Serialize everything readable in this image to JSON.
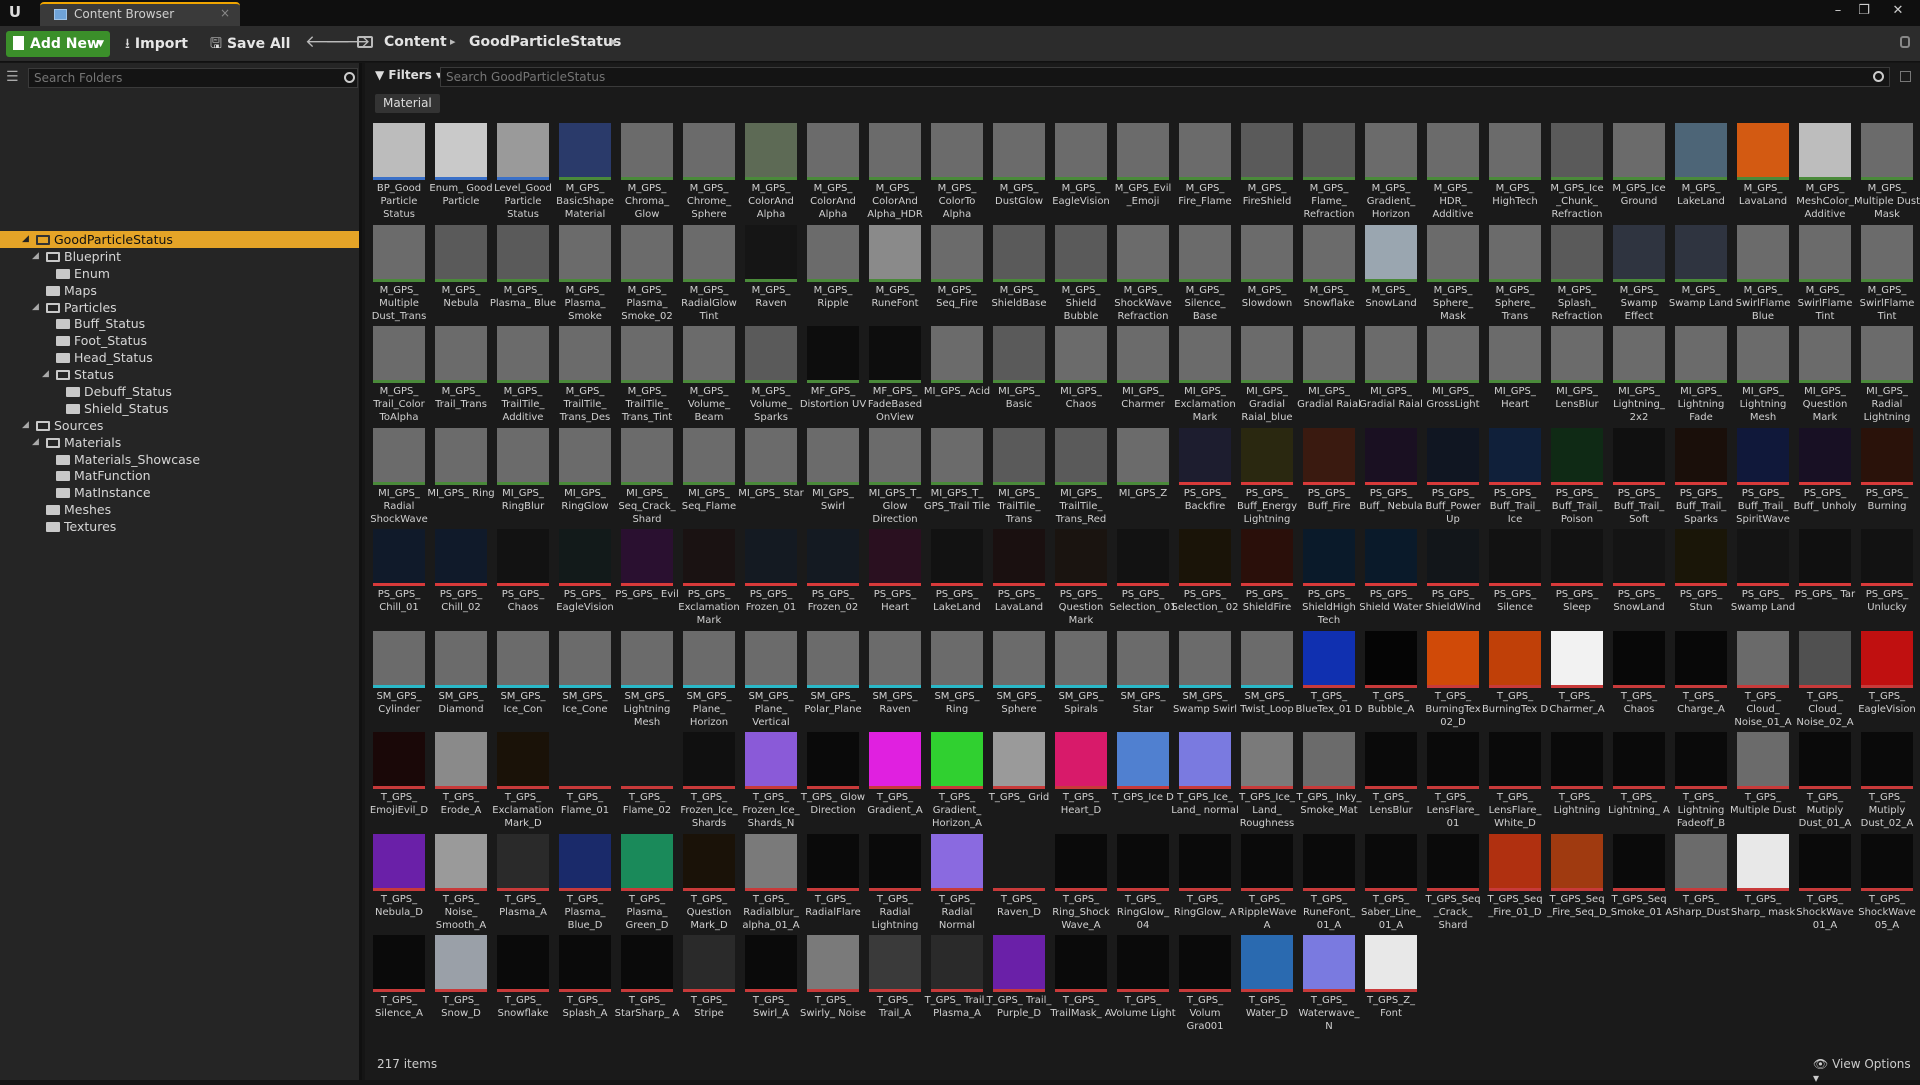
{
  "window": {
    "tab_title": "Content Browser",
    "logo": "U",
    "close": "×",
    "win_min": "–",
    "win_max": "❐",
    "win_close": "✕"
  },
  "toolbar": {
    "add_new": "Add New",
    "import": "Import",
    "save_all": "Save All",
    "back": "🡐",
    "forward": "🡒",
    "crumbs": [
      "Content",
      "GoodParticleStatus"
    ],
    "sep": "▸"
  },
  "sidebar": {
    "search_placeholder": "Search Folders",
    "tree": [
      {
        "label": "GoodParticleStatus",
        "depth": 0,
        "open": true,
        "selected": true
      },
      {
        "label": "Blueprint",
        "depth": 1,
        "open": true
      },
      {
        "label": "Enum",
        "depth": 2
      },
      {
        "label": "Maps",
        "depth": 1
      },
      {
        "label": "Particles",
        "depth": 1,
        "open": true
      },
      {
        "label": "Buff_Status",
        "depth": 2
      },
      {
        "label": "Foot_Status",
        "depth": 2
      },
      {
        "label": "Head_Status",
        "depth": 2
      },
      {
        "label": "Status",
        "depth": 2,
        "open": true
      },
      {
        "label": "Debuff_Status",
        "depth": 3
      },
      {
        "label": "Shield_Status",
        "depth": 3
      },
      {
        "label": "Sources",
        "depth": 0,
        "open": true
      },
      {
        "label": "Materials",
        "depth": 1,
        "open": true
      },
      {
        "label": "Materials_Showcase",
        "depth": 2
      },
      {
        "label": "MatFunction",
        "depth": 2
      },
      {
        "label": "MatInstance",
        "depth": 2
      },
      {
        "label": "Meshes",
        "depth": 1
      },
      {
        "label": "Textures",
        "depth": 1
      }
    ]
  },
  "main": {
    "filters_label": "Filters",
    "search_placeholder": "Search GoodParticleStatus",
    "filter_chip": "Material",
    "item_count": "217 items",
    "view_options": "View Options"
  },
  "assets": [
    [
      "BP_Good Particle Status",
      "#bcbcbc"
    ],
    [
      "Enum_ Good Particle",
      "#c9c9c9"
    ],
    [
      "Level_Good Particle Status",
      "#9a9a9a"
    ],
    [
      "M_GPS_ BasicShape Material",
      "#2a3a6a"
    ],
    [
      "M_GPS_ Chroma_ Glow",
      "#6b6b6b"
    ],
    [
      "M_GPS_ Chrome_ Sphere",
      "#6b6b6b"
    ],
    [
      "M_GPS_ ColorAnd Alpha",
      "#5d6a55"
    ],
    [
      "M_GPS_ ColorAnd Alpha",
      "#6b6b6b"
    ],
    [
      "M_GPS_ ColorAnd Alpha_HDR",
      "#6b6b6b"
    ],
    [
      "M_GPS_ ColorTo Alpha",
      "#6b6b6b"
    ],
    [
      "M_GPS_ DustGlow",
      "#6b6b6b"
    ],
    [
      "M_GPS_ EagleVision",
      "#6b6b6b"
    ],
    [
      "M_GPS_Evil _Emoji",
      "#6b6b6b"
    ],
    [
      "M_GPS_ Fire_Flame",
      "#6b6b6b"
    ],
    [
      "M_GPS_ FireShield",
      "#5a5a5a"
    ],
    [
      "M_GPS_ Flame_ Refraction",
      "#5a5a5a"
    ],
    [
      "M_GPS_ Gradient_ Horizon",
      "#6b6b6b"
    ],
    [
      "M_GPS_ HDR_ Additive",
      "#6b6b6b"
    ],
    [
      "M_GPS_ HighTech",
      "#6b6b6b"
    ],
    [
      "M_GPS_Ice _Chunk_ Refraction",
      "#5a5a5a"
    ],
    [
      "M_GPS_Ice Ground",
      "#6b6b6b"
    ],
    [
      "M_GPS_ LakeLand",
      "#4d6577"
    ],
    [
      "M_GPS_ LavaLand",
      "#d35a12"
    ],
    [
      "M_GPS_ MeshColor_ Additive",
      "#bdbdbd"
    ],
    [
      "M_GPS_ Multiple Dust Mask",
      "#6b6b6b"
    ],
    [
      "M_GPS_ Multiple Dust_Trans",
      "#6b6b6b"
    ],
    [
      "M_GPS_ Nebula",
      "#5a5a5a"
    ],
    [
      "M_GPS_ Plasma_ Blue",
      "#5a5a5a"
    ],
    [
      "M_GPS_ Plasma_ Smoke",
      "#6b6b6b"
    ],
    [
      "M_GPS_ Plasma_ Smoke_02",
      "#6b6b6b"
    ],
    [
      "M_GPS_ RadialGlow Tint",
      "#6b6b6b"
    ],
    [
      "M_GPS_ Raven",
      "#151515"
    ],
    [
      "M_GPS_ Ripple",
      "#6b6b6b"
    ],
    [
      "M_GPS_ RuneFont",
      "#8a8a8a"
    ],
    [
      "M_GPS_ Seq_Fire",
      "#6b6b6b"
    ],
    [
      "M_GPS_ ShieldBase",
      "#5a5a5a"
    ],
    [
      "M_GPS_ Shield Bubble",
      "#5a5a5a"
    ],
    [
      "M_GPS_ ShockWave Refraction",
      "#6b6b6b"
    ],
    [
      "M_GPS_ Silence_ Base",
      "#6b6b6b"
    ],
    [
      "M_GPS_ Slowdown",
      "#6b6b6b"
    ],
    [
      "M_GPS_ Snowflake",
      "#6b6b6b"
    ],
    [
      "M_GPS_ SnowLand",
      "#9aa6b0"
    ],
    [
      "M_GPS_ Sphere_ Mask",
      "#6b6b6b"
    ],
    [
      "M_GPS_ Sphere_ Trans",
      "#6b6b6b"
    ],
    [
      "M_GPS_ Splash_ Refraction",
      "#5a5a5a"
    ],
    [
      "M_GPS_ Swamp Effect",
      "#2f3440"
    ],
    [
      "M_GPS_ Swamp Land",
      "#2f3440"
    ],
    [
      "M_GPS_ SwirlFlame Blue",
      "#6b6b6b"
    ],
    [
      "M_GPS_ SwirlFlame Tint",
      "#6b6b6b"
    ],
    [
      "M_GPS_ SwirlFlame Tint",
      "#6b6b6b"
    ],
    [
      "M_GPS_ Trail_Color ToAlpha",
      "#6b6b6b"
    ],
    [
      "M_GPS_ Trail_Trans",
      "#6b6b6b"
    ],
    [
      "M_GPS_ TrailTile_ Additive",
      "#6b6b6b"
    ],
    [
      "M_GPS_ TrailTile_ Trans_Des",
      "#6b6b6b"
    ],
    [
      "M_GPS_ TrailTile_ Trans_Tint",
      "#6b6b6b"
    ],
    [
      "M_GPS_ Volume_ Beam",
      "#6b6b6b"
    ],
    [
      "M_GPS_ Volume_ Sparks",
      "#5a5a5a"
    ],
    [
      "MF_GPS_ Distortion UV",
      "#0d0d0d"
    ],
    [
      "MF_GPS_ FadeBased OnView",
      "#0d0d0d"
    ],
    [
      "MI_GPS_ Acid",
      "#6b6b6b"
    ],
    [
      "MI_GPS_ Basic",
      "#5a5a5a"
    ],
    [
      "MI_GPS_ Chaos",
      "#6b6b6b"
    ],
    [
      "MI_GPS_ Charmer",
      "#6b6b6b"
    ],
    [
      "MI_GPS_ Exclamation Mark",
      "#6b6b6b"
    ],
    [
      "MI_GPS_ Gradial Raial_blue",
      "#6b6b6b"
    ],
    [
      "MI_GPS_ Gradial Raial",
      "#6b6b6b"
    ],
    [
      "MI_GPS_ Gradial Raial",
      "#6b6b6b"
    ],
    [
      "MI_GPS_ GrossLight",
      "#6b6b6b"
    ],
    [
      "MI_GPS_ Heart",
      "#6b6b6b"
    ],
    [
      "MI_GPS_ LensBlur",
      "#6b6b6b"
    ],
    [
      "MI_GPS_ Lightning_ 2x2",
      "#6b6b6b"
    ],
    [
      "MI_GPS_ Lightning Fade",
      "#6b6b6b"
    ],
    [
      "MI_GPS_ Lightning Mesh",
      "#6b6b6b"
    ],
    [
      "MI_GPS_ Question Mark",
      "#6b6b6b"
    ],
    [
      "MI_GPS_ Radial Lightning",
      "#6b6b6b"
    ],
    [
      "MI_GPS_ Radial ShockWave",
      "#6b6b6b"
    ],
    [
      "MI_GPS_ Ring",
      "#6b6b6b"
    ],
    [
      "MI_GPS_ RingBlur",
      "#6b6b6b"
    ],
    [
      "MI_GPS_ RingGlow",
      "#6b6b6b"
    ],
    [
      "MI_GPS_ Seq_Crack_ Shard",
      "#6b6b6b"
    ],
    [
      "MI_GPS_ Seq_Flame",
      "#6b6b6b"
    ],
    [
      "MI_GPS_ Star",
      "#6b6b6b"
    ],
    [
      "MI_GPS_ Swirl",
      "#6b6b6b"
    ],
    [
      "MI_GPS_T_ Glow Direction",
      "#6b6b6b"
    ],
    [
      "MI_GPS_T_ GPS_Trail Tile",
      "#6b6b6b"
    ],
    [
      "MI_GPS_ TrailTile_ Trans",
      "#5a5a5a"
    ],
    [
      "MI_GPS_ TrailTile_ Trans_Red",
      "#5a5a5a"
    ],
    [
      "MI_GPS_Z",
      "#6b6b6b"
    ],
    [
      "PS_GPS_ Backfire",
      "#1d1d2f"
    ],
    [
      "PS_GPS_ Buff_Energy Lightning",
      "#2a2810"
    ],
    [
      "PS_GPS_ Buff_Fire",
      "#3a1a10"
    ],
    [
      "PS_GPS_ Buff_ Nebula",
      "#1a1022"
    ],
    [
      "PS_GPS_ Buff_Power Up",
      "#101622"
    ],
    [
      "PS_GPS_ Buff_Trail_ Ice",
      "#10203a"
    ],
    [
      "PS_GPS_ Buff_Trail_ Poison",
      "#0f2a15"
    ],
    [
      "PS_GPS_ Buff_Trail_ Soft",
      "#101010"
    ],
    [
      "PS_GPS_ Buff_Trail_ Sparks",
      "#1a0f0a"
    ],
    [
      "PS_GPS_ Buff_Trail_ SpiritWave",
      "#10183a"
    ],
    [
      "PS_GPS_ Buff_ Unholy",
      "#181024"
    ],
    [
      "PS_GPS_ Burning",
      "#2a120a"
    ],
    [
      "PS_GPS_ Chill_01",
      "#101a2a"
    ],
    [
      "PS_GPS_ Chill_02",
      "#101a2a"
    ],
    [
      "PS_GPS_ Chaos",
      "#121212"
    ],
    [
      "PS_GPS_ EagleVision",
      "#121a1a"
    ],
    [
      "PS_GPS_ Evil",
      "#2a1030"
    ],
    [
      "PS_GPS_ Exclamation Mark",
      "#1a1212"
    ],
    [
      "PS_GPS_ Frozen_01",
      "#141a22"
    ],
    [
      "PS_GPS_ Frozen_02",
      "#141a22"
    ],
    [
      "PS_GPS_ Heart",
      "#2a1020"
    ],
    [
      "PS_GPS_ LakeLand",
      "#121212"
    ],
    [
      "PS_GPS_ LavaLand",
      "#1a1010"
    ],
    [
      "PS_GPS_ Question Mark",
      "#1a1410"
    ],
    [
      "PS_GPS_ Selection_ 01",
      "#121212"
    ],
    [
      "PS_GPS_ Selection_ 02",
      "#1a1408"
    ],
    [
      "PS_GPS_ ShieldFire",
      "#2a0f0a"
    ],
    [
      "PS_GPS_ ShieldHigh Tech",
      "#0a1a2a"
    ],
    [
      "PS_GPS_ Shield Water",
      "#0a1a2a"
    ],
    [
      "PS_GPS_ ShieldWind",
      "#12161a"
    ],
    [
      "PS_GPS_ Silence",
      "#121212"
    ],
    [
      "PS_GPS_ Sleep",
      "#121212"
    ],
    [
      "PS_GPS_ SnowLand",
      "#141414"
    ],
    [
      "PS_GPS_ Stun",
      "#1a1608"
    ],
    [
      "PS_GPS_ Swamp Land",
      "#141414"
    ],
    [
      "PS_GPS_ Tar",
      "#101010"
    ],
    [
      "PS_GPS_ Unlucky",
      "#121212"
    ],
    [
      "SM_GPS_ Cylinder",
      "#6b6b6b"
    ],
    [
      "SM_GPS_ Diamond",
      "#6b6b6b"
    ],
    [
      "SM_GPS_ Ice_Con",
      "#6b6b6b"
    ],
    [
      "SM_GPS_ Ice_Cone",
      "#6b6b6b"
    ],
    [
      "SM_GPS_ Lightning Mesh",
      "#6b6b6b"
    ],
    [
      "SM_GPS_ Plane_ Horizon",
      "#6b6b6b"
    ],
    [
      "SM_GPS_ Plane_ Vertical",
      "#6b6b6b"
    ],
    [
      "SM_GPS_ Polar_Plane",
      "#6b6b6b"
    ],
    [
      "SM_GPS_ Raven",
      "#6b6b6b"
    ],
    [
      "SM_GPS_ Ring",
      "#6b6b6b"
    ],
    [
      "SM_GPS_ Sphere",
      "#6b6b6b"
    ],
    [
      "SM_GPS_ Spirals",
      "#6b6b6b"
    ],
    [
      "SM_GPS_ Star",
      "#6b6b6b"
    ],
    [
      "SM_GPS_ Swamp Swirl",
      "#6b6b6b"
    ],
    [
      "SM_GPS_ Twist_Loop",
      "#6b6b6b"
    ],
    [
      "T_GPS_ BlueTex_01 D",
      "#1030b0"
    ],
    [
      "T_GPS_ Bubble_A",
      "#050505"
    ],
    [
      "T_GPS_ BurningTex 02_D",
      "#d04a08"
    ],
    [
      "T_GPS_ BurningTex D",
      "#c04008"
    ],
    [
      "T_GPS_ Charmer_A",
      "#f2f2f2"
    ],
    [
      "T_GPS_ Chaos",
      "#080808"
    ],
    [
      "T_GPS_ Charge_A",
      "#080808"
    ],
    [
      "T_GPS_ Cloud_ Noise_01_A",
      "#6a6a6a"
    ],
    [
      "T_GPS_ Cloud_ Noise_02_A",
      "#505050"
    ],
    [
      "T_GPS_ EagleVision",
      "#c01010"
    ],
    [
      "T_GPS_ EmojiEvil_D",
      "#1a0808"
    ],
    [
      "T_GPS_ Erode_A",
      "#8a8a8a"
    ],
    [
      "T_GPS_ Exclamation Mark_D",
      "#1a1208"
    ],
    [
      "T_GPS_ Flame_01",
      "#1a1a1a"
    ],
    [
      "T_GPS_ Flame_02",
      "#1a1a1a"
    ],
    [
      "T_GPS_ Frozen_Ice_ Shards",
      "#101010"
    ],
    [
      "T_GPS_ Frozen_Ice_ Shards_N",
      "#8a5ad8"
    ],
    [
      "T_GPS_ Glow Direction",
      "#0a0a0a"
    ],
    [
      "T_GPS_ Gradient_A",
      "#e020e0"
    ],
    [
      "T_GPS_ Gradient_ Horizon_A",
      "#30d030"
    ],
    [
      "T_GPS_ Grid",
      "#9a9a9a"
    ],
    [
      "T_GPS_ Heart_D",
      "#d81a6a"
    ],
    [
      "T_GPS_Ice D",
      "#5080d0"
    ],
    [
      "T_GPS_Ice_ Land_ normal",
      "#7a7ae0"
    ],
    [
      "T_GPS_Ice_ Land_ Roughness",
      "#7a7a7a"
    ],
    [
      "T_GPS_ Inky_ Smoke_Mat",
      "#6b6b6b"
    ],
    [
      "T_GPS_ LensBlur",
      "#0a0a0a"
    ],
    [
      "T_GPS_ LensFlare_ 01",
      "#0a0a0a"
    ],
    [
      "T_GPS_ LensFlare_ White_D",
      "#0a0a0a"
    ],
    [
      "T_GPS_ Lightning",
      "#0a0a0a"
    ],
    [
      "T_GPS_ Lightning_ A",
      "#0a0a0a"
    ],
    [
      "T_GPS_ Lightning Fadeoff_B",
      "#0a0a0a"
    ],
    [
      "T_GPS_ Multiple Dust",
      "#6b6b6b"
    ],
    [
      "T_GPS_ Mutiply Dust_01_A",
      "#0a0a0a"
    ],
    [
      "T_GPS_ Mutiply Dust_02_A",
      "#0a0a0a"
    ],
    [
      "T_GPS_ Nebula_D",
      "#6a20a8"
    ],
    [
      "T_GPS_ Noise_ Smooth_A",
      "#9a9a9a"
    ],
    [
      "T_GPS_ Plasma_A",
      "#2a2a2a"
    ],
    [
      "T_GPS_ Plasma_ Blue_D",
      "#1a2a6a"
    ],
    [
      "T_GPS_ Plasma_ Green_D",
      "#1a8a5a"
    ],
    [
      "T_GPS_ Question Mark_D",
      "#1a1208"
    ],
    [
      "T_GPS_ Radialblur_ alpha_01_A",
      "#7a7a7a"
    ],
    [
      "T_GPS_ RadialFlare",
      "#0a0a0a"
    ],
    [
      "T_GPS_ Radial Lightning",
      "#0a0a0a"
    ],
    [
      "T_GPS_ Radial Normal",
      "#8a6ae0"
    ],
    [
      "T_GPS_ Raven_D",
      "#1a1a1a"
    ],
    [
      "T_GPS_ Ring_Shock Wave_A",
      "#0a0a0a"
    ],
    [
      "T_GPS_ RingGlow_ 04",
      "#0a0a0a"
    ],
    [
      "T_GPS_ RingGlow_ A",
      "#0a0a0a"
    ],
    [
      "T_GPS_ RippleWave A",
      "#0a0a0a"
    ],
    [
      "T_GPS_ RuneFont_ 01_A",
      "#0a0a0a"
    ],
    [
      "T_GPS_ Saber_Line_ 01_A",
      "#0a0a0a"
    ],
    [
      "T_GPS_Seq _Crack_ Shard",
      "#0a0a0a"
    ],
    [
      "T_GPS_Seq _Fire_01_D",
      "#b03010"
    ],
    [
      "T_GPS_Seq _Fire_Seq_D",
      "#a03a10"
    ],
    [
      "T_GPS_Seq _Smoke_01 A",
      "#0a0a0a"
    ],
    [
      "T_GPS_ Sharp_Dust",
      "#6b6b6b"
    ],
    [
      "T_GPS_ Sharp_ mask",
      "#e8e8e8"
    ],
    [
      "T_GPS_ ShockWave 01_A",
      "#0a0a0a"
    ],
    [
      "T_GPS_ ShockWave 05_A",
      "#0a0a0a"
    ],
    [
      "T_GPS_ Silence_A",
      "#0a0a0a"
    ],
    [
      "T_GPS_ Snow_D",
      "#9aa0a8"
    ],
    [
      "T_GPS_ Snowflake",
      "#0a0a0a"
    ],
    [
      "T_GPS_ Splash_A",
      "#0a0a0a"
    ],
    [
      "T_GPS_ StarSharp_ A",
      "#0a0a0a"
    ],
    [
      "T_GPS_ Stripe",
      "#2a2a2a"
    ],
    [
      "T_GPS_ Swirl_A",
      "#0a0a0a"
    ],
    [
      "T_GPS_ Swirly_ Noise",
      "#7a7a7a"
    ],
    [
      "T_GPS_ Trail_A",
      "#3a3a3a"
    ],
    [
      "T_GPS_ Trail_ Plasma_A",
      "#2a2a2a"
    ],
    [
      "T_GPS_ Trail_ Purple_D",
      "#6a20a8"
    ],
    [
      "T_GPS_ TrailMask_ A",
      "#0a0a0a"
    ],
    [
      "T_GPS_ Volume Light",
      "#0a0a0a"
    ],
    [
      "T_GPS_ Volum Gra001",
      "#0a0a0a"
    ],
    [
      "T_GPS_ Water_D",
      "#2a6ab0"
    ],
    [
      "T_GPS_ Waterwave_ N",
      "#7a7ae0"
    ],
    [
      "T_GPS_Z_ Font",
      "#e8e8e8"
    ]
  ],
  "colors": {
    "accent": "#e5a427",
    "add_new": "#3b8f2a",
    "bar_material": "#4a8a3a",
    "bar_particle": "#d83a3a",
    "bar_mesh": "#2ab8c8",
    "bar_texture": "#c83a3a",
    "bar_blueprint": "#3a70c8"
  }
}
